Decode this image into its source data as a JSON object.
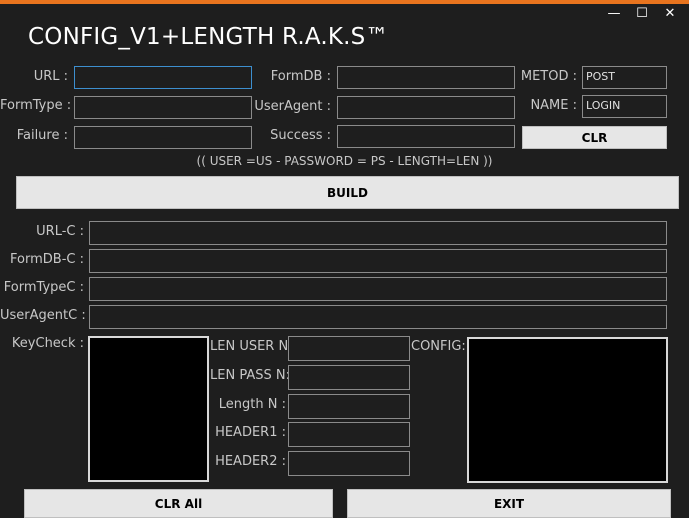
{
  "window": {
    "title": "CONFIG_V1+LENGTH R.A.K.S™",
    "controls": {
      "minimize": "—",
      "maximize": "☐",
      "close": "✕"
    }
  },
  "form": {
    "url_label": "URL :",
    "formdb_label": "FormDB :",
    "metod_label": "METOD :",
    "metod_value": "POST",
    "formtype_label": "FormType :",
    "useragent_label": "UserAgent :",
    "name_label": "NAME :",
    "name_value": "LOGIN",
    "failure_label": "Failure :",
    "success_label": "Success :",
    "clr_button": "CLR",
    "hint": "(( USER =US - PASSWORD = PS - LENGTH=LEN ))",
    "build_button": "BUILD"
  },
  "output": {
    "urlc_label": "URL-C :",
    "formdbc_label": "FormDB-C :",
    "formtypec_label": "FormTypeC :",
    "useragentc_label": "UserAgentC :",
    "keycheck_label": "KeyCheck :",
    "len_user_label": "LEN USER N:",
    "len_pass_label": "LEN PASS N:",
    "length_label": "Length N :",
    "header1_label": "HEADER1 :",
    "header2_label": "HEADER2 :",
    "config_label": "CONFIG:"
  },
  "footer": {
    "clr_all_button": "CLR All",
    "exit_button": "EXIT"
  }
}
